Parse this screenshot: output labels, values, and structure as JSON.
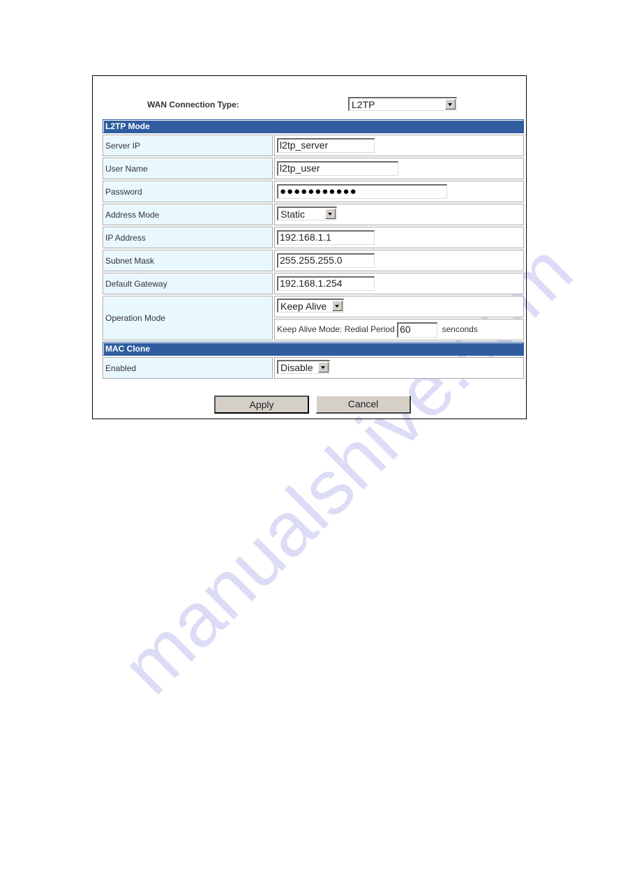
{
  "watermark": "manualshive.com",
  "wan": {
    "label": "WAN Connection Type:",
    "selected": "L2TP"
  },
  "l2tp_section": {
    "title": "L2TP Mode",
    "server_ip": {
      "label": "Server IP",
      "value": "l2tp_server"
    },
    "user_name": {
      "label": "User Name",
      "value": "l2tp_user"
    },
    "password": {
      "label": "Password",
      "value": "●●●●●●●●●●●"
    },
    "address_mode": {
      "label": "Address Mode",
      "selected": "Static"
    },
    "ip_address": {
      "label": "IP Address",
      "value": "192.168.1.1"
    },
    "subnet_mask": {
      "label": "Subnet Mask",
      "value": "255.255.255.0"
    },
    "default_gateway": {
      "label": "Default Gateway",
      "value": "192.168.1.254"
    },
    "operation_mode": {
      "label": "Operation Mode",
      "selected": "Keep Alive",
      "redial_label": "Keep Alive Mode: Redial Period",
      "redial_value": "60",
      "redial_unit": "senconds"
    }
  },
  "mac_clone_section": {
    "title": "MAC Clone",
    "enabled": {
      "label": "Enabled",
      "selected": "Disable"
    }
  },
  "buttons": {
    "apply": "Apply",
    "cancel": "Cancel"
  },
  "colors": {
    "section_header": "#2f5d9f",
    "label_bg": "#e9f8ff"
  }
}
